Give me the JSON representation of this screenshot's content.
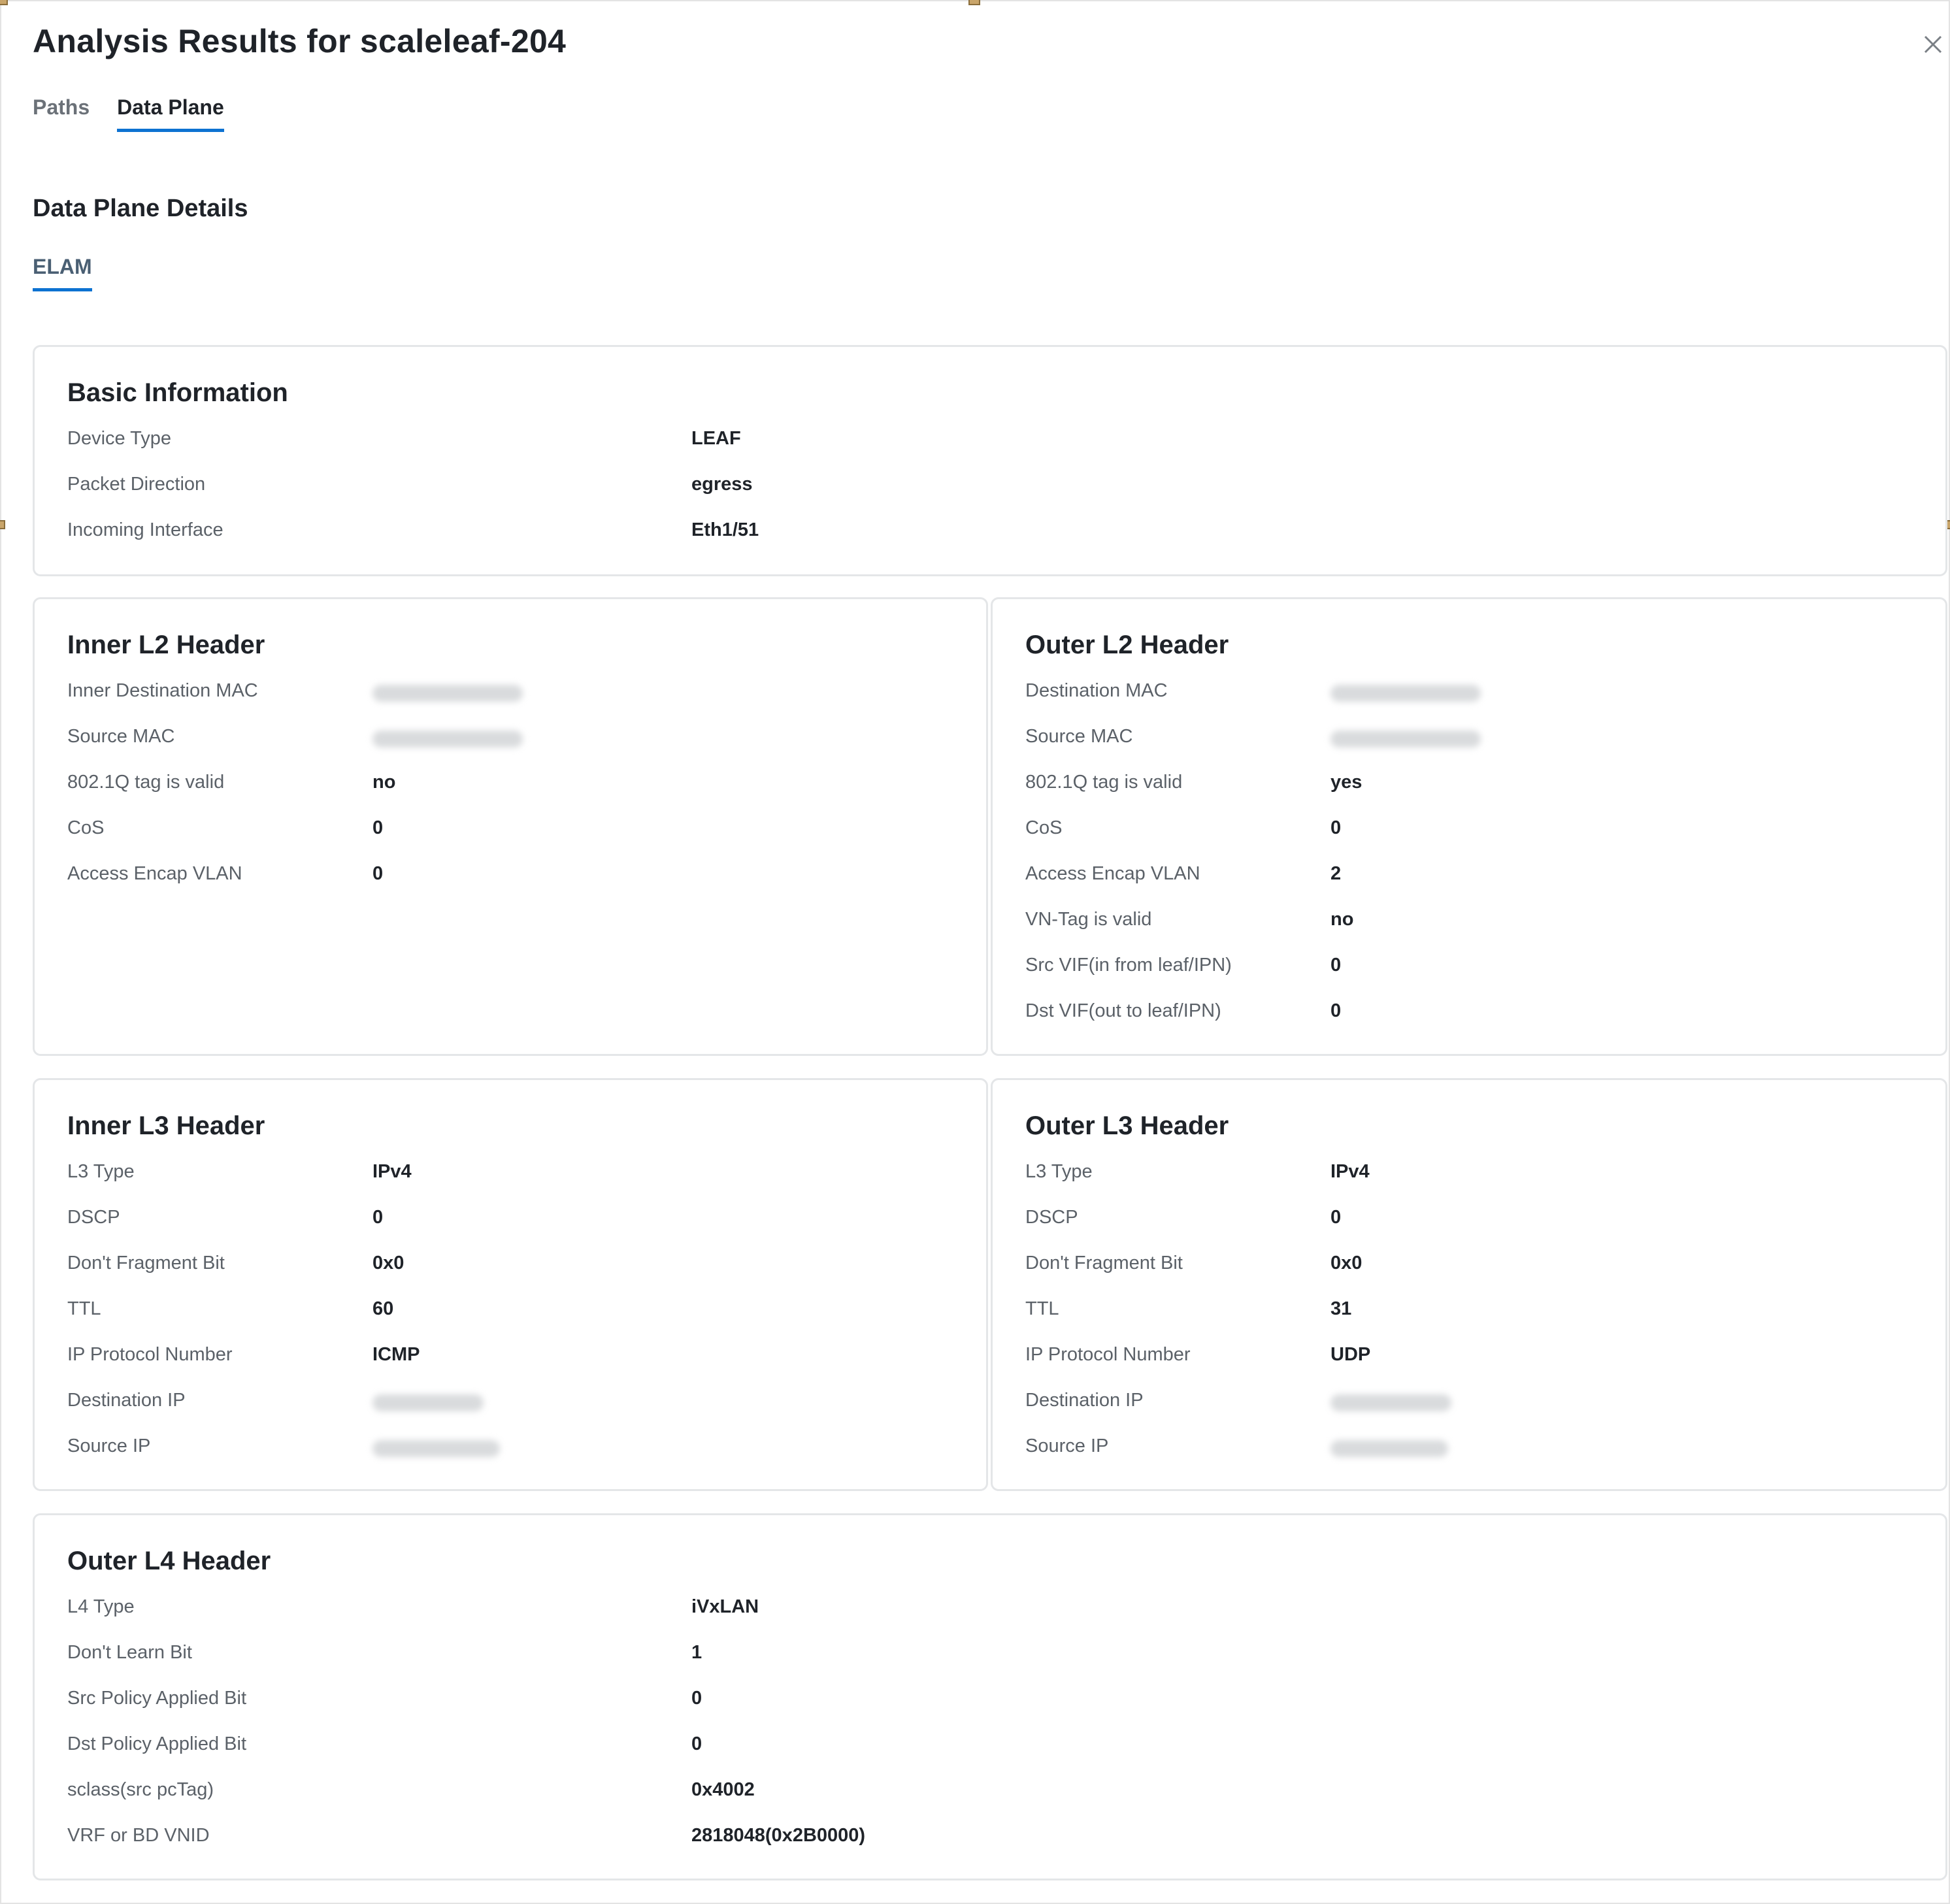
{
  "dialog": {
    "title": "Analysis Results for scaleleaf-204",
    "close_icon": "close-icon"
  },
  "tabs": [
    {
      "label": "Paths",
      "active": false
    },
    {
      "label": "Data Plane",
      "active": true
    }
  ],
  "section": {
    "title": "Data Plane Details",
    "subtab": "ELAM"
  },
  "basic": {
    "title": "Basic Information",
    "rows": [
      {
        "label": "Device Type",
        "value": "LEAF"
      },
      {
        "label": "Packet Direction",
        "value": "egress"
      },
      {
        "label": "Incoming Interface",
        "value": "Eth1/51"
      }
    ]
  },
  "inner_l2": {
    "title": "Inner L2 Header",
    "rows": [
      {
        "label": "Inner Destination MAC",
        "value": "",
        "redacted": true
      },
      {
        "label": "Source MAC",
        "value": "",
        "redacted": true
      },
      {
        "label": "802.1Q tag is valid",
        "value": "no"
      },
      {
        "label": "CoS",
        "value": "0"
      },
      {
        "label": "Access Encap VLAN",
        "value": "0"
      }
    ]
  },
  "outer_l2": {
    "title": "Outer L2 Header",
    "rows": [
      {
        "label": "Destination MAC",
        "value": "",
        "redacted": true
      },
      {
        "label": "Source MAC",
        "value": "",
        "redacted": true
      },
      {
        "label": "802.1Q tag is valid",
        "value": "yes"
      },
      {
        "label": "CoS",
        "value": "0"
      },
      {
        "label": "Access Encap VLAN",
        "value": "2"
      },
      {
        "label": "VN-Tag is valid",
        "value": "no"
      },
      {
        "label": "Src VIF(in from leaf/IPN)",
        "value": "0"
      },
      {
        "label": "Dst VIF(out to leaf/IPN)",
        "value": "0"
      }
    ]
  },
  "inner_l3": {
    "title": "Inner L3 Header",
    "rows": [
      {
        "label": "L3 Type",
        "value": "IPv4"
      },
      {
        "label": "DSCP",
        "value": "0"
      },
      {
        "label": "Don't Fragment Bit",
        "value": "0x0"
      },
      {
        "label": "TTL",
        "value": "60"
      },
      {
        "label": "IP Protocol Number",
        "value": "ICMP"
      },
      {
        "label": "Destination IP",
        "value": "",
        "redacted": true
      },
      {
        "label": "Source IP",
        "value": "",
        "redacted": true
      }
    ]
  },
  "outer_l3": {
    "title": "Outer L3 Header",
    "rows": [
      {
        "label": "L3 Type",
        "value": "IPv4"
      },
      {
        "label": "DSCP",
        "value": "0"
      },
      {
        "label": "Don't Fragment Bit",
        "value": "0x0"
      },
      {
        "label": "TTL",
        "value": "31"
      },
      {
        "label": "IP Protocol Number",
        "value": "UDP"
      },
      {
        "label": "Destination IP",
        "value": "",
        "redacted": true
      },
      {
        "label": "Source IP",
        "value": "",
        "redacted": true
      }
    ]
  },
  "outer_l4": {
    "title": "Outer L4 Header",
    "rows": [
      {
        "label": "L4 Type",
        "value": "iVxLAN"
      },
      {
        "label": "Don't Learn Bit",
        "value": "1"
      },
      {
        "label": "Src Policy Applied Bit",
        "value": "0"
      },
      {
        "label": "Dst Policy Applied Bit",
        "value": "0"
      },
      {
        "label": "sclass(src pcTag)",
        "value": "0x4002"
      },
      {
        "label": "VRF or BD VNID",
        "value": "2818048(0x2B0000)"
      }
    ]
  },
  "colors": {
    "accent": "#0d72d1",
    "text": "#1f2329",
    "muted": "#5b6168",
    "border": "#e4e6e8"
  }
}
